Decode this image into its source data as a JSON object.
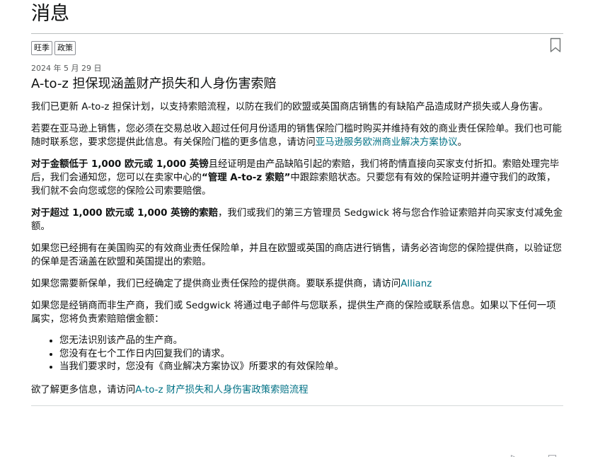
{
  "header": {
    "title": "消息"
  },
  "tags": [
    "旺季",
    "政策"
  ],
  "article": {
    "date": "2024 年 5 月 29 日",
    "title": "A-to-z 担保现涵盖财产损失和人身伤害索赔",
    "p1": "我们已更新 A-to-z 担保计划，以支持索赔流程，以防在我们的欧盟或英国商店销售的有缺陷产品造成财产损失或人身伤害。",
    "p2_text": "若要在亚马逊上销售，您必须在交易总收入超过任何月份适用的销售保险门槛时购买并维持有效的商业责任保险单。我们也可能随时联系您，要求您提供此信息。有关保险门槛的更多信息，请访问",
    "p2_link": "亚马逊服务欧洲商业解决方案协议",
    "p2_end": "。",
    "p3_bold": "对于金额低于 1,000 欧元或 1,000 英镑",
    "p3_mid": "且经证明是由产品缺陷引起的索赔，我们将酌情直接向买家支付折扣。索赔处理完毕后，我们会通知您，您可以在卖家中心的",
    "p3_bold2": "“管理 A-to-z 索赔”",
    "p3_end": "中跟踪索赔状态。只要您有有效的保险证明并遵守我们的政策，我们就不会向您或您的保险公司索要赔偿。",
    "p4_bold": "对于超过 1,000 欧元或 1,000 英镑的索赔",
    "p4_end": "，我们或我们的第三方管理员 Sedgwick 将与您合作验证索赔并向买家支付减免金额。",
    "p5": "如果您已经拥有在美国购买的有效商业责任保险单，并且在欧盟或英国的商店进行销售，请务必咨询您的保险提供商，以验证您的保单是否涵盖在欧盟和英国提出的索赔。",
    "p6_text": "如果您需要新保单，我们已经确定了提供商业责任保险的提供商。要联系提供商，请访问",
    "p6_link": "Allianz",
    "p7": "如果您是经销商而非生产商，我们或 Sedgwick 将通过电子邮件与您联系，提供生产商的保险或联系信息。如果以下任何一项属实，您将负责索赔赔偿金额：",
    "bullets": [
      "您无法识别该产品的生产商。",
      "您没有在七个工作日内回复我们的请求。",
      "当我们要求时，您没有《商业解决方案协议》所要求的有效保险单。"
    ],
    "p8_text": "欲了解更多信息，请访问",
    "p8_link": "A-to-z 财产损失和人身伤害政策索赔流程"
  },
  "icons": {
    "bookmark": "bookmark-icon",
    "footer_left": "thumbs-up-icon",
    "footer_right": "comment-icon"
  },
  "colors": {
    "link": "#007185",
    "text": "#0f1111",
    "muted": "#565959"
  }
}
